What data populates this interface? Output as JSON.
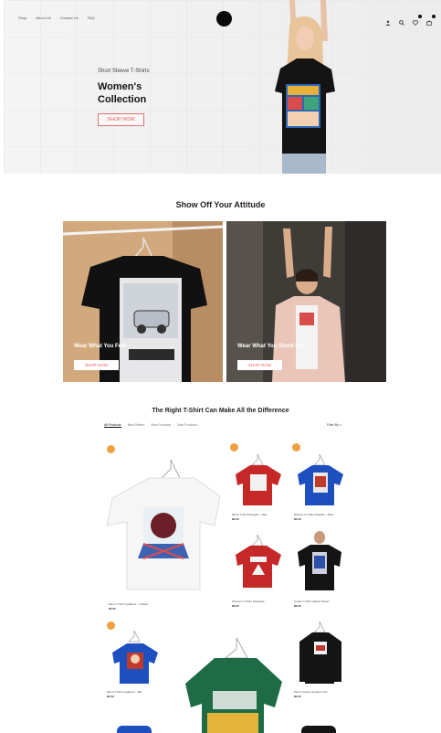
{
  "nav": {
    "items": [
      {
        "label": "Shop"
      },
      {
        "label": "About Us"
      },
      {
        "label": "Contact Us"
      },
      {
        "label": "FAQ"
      }
    ]
  },
  "hero": {
    "subtitle": "Short Sleeve T-Shirts",
    "title_line1": "Women's",
    "title_line2": "Collection",
    "cta": "SHOP NOW"
  },
  "section1": {
    "title": "Show Off Your Attitude",
    "tiles": [
      {
        "caption": "Wear What You Feel",
        "cta": "SHOP NOW"
      },
      {
        "caption": "Wear What You Stand For",
        "cta": "SHOP NOW"
      }
    ]
  },
  "section2": {
    "title": "The Right T-Shirt Can Make All the Difference",
    "tabs": [
      {
        "label": "All Products"
      },
      {
        "label": "Best Sellers"
      },
      {
        "label": "New Products"
      },
      {
        "label": "Sale Products"
      }
    ],
    "filter_label": "Filter By"
  },
  "products": [
    {
      "name": "Men's T-Shirt Lyallpore – Charlie",
      "price": "$0.00",
      "color": "#f7f7f7"
    },
    {
      "name": "Men's T-Shirt Shapalu – Red",
      "price": "$0.00",
      "color": "#c62828"
    },
    {
      "name": "Women's T-Shirt Shapalu – Blue",
      "price": "$0.00",
      "color": "#1e4fbf"
    },
    {
      "name": "Women's T-Shirt Nestpoint",
      "price": "$0.00",
      "color": "#c62828"
    },
    {
      "name": "Unisex T-Shirt Classic Model",
      "price": "$0.00",
      "color": "#141414"
    },
    {
      "name": "Men's T-Shirt Lyallpore – Blu",
      "price": "$0.00",
      "color": "#1e4fbf"
    },
    {
      "name": "",
      "price": "",
      "color": "#1f6b45"
    },
    {
      "name": "Men's Unisex Hoodie & Tee",
      "price": "$0.00",
      "color": "#141414"
    }
  ],
  "colors": {
    "accent": "#e06060",
    "sale_badge": "#f0a040"
  }
}
